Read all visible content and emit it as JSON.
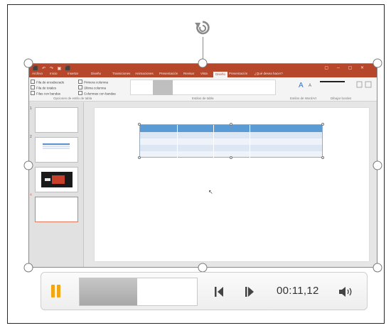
{
  "video_frame": {
    "tabs": [
      "Archivo",
      "Inicio",
      "Insertar",
      "Diseño",
      "Transiciones",
      "Animaciones",
      "Presentación",
      "Revisar",
      "Vista",
      "Diseño",
      "Presentación",
      "¿Qué desea hacer?"
    ],
    "active_tab_index": 8,
    "ribbon_options": [
      "Fila de encabezado",
      "Fila de totales",
      "Filas con bandas",
      "Primera columna",
      "Última columna",
      "Columnas con bandas"
    ],
    "ribbon_groups": [
      "Opciones de estilo de tabla",
      "Estilos de tabla",
      "Estilos de WordArt",
      "Dibujar bordes"
    ],
    "slide_numbers": [
      "1",
      "2",
      "3",
      "4"
    ],
    "selected_slide_index": 3,
    "colors": {
      "ribbon": "#b7472a",
      "table_header": "#5b9bd5",
      "thumbnail_selected": "#e8765a"
    }
  },
  "player": {
    "time": "00:11,12",
    "progress_fraction": 0.49,
    "accent_color": "#f2a515",
    "icons": {
      "play_pause": "pause-icon",
      "previous": "step-back-icon",
      "next": "step-forward-icon",
      "volume": "volume-icon"
    }
  }
}
